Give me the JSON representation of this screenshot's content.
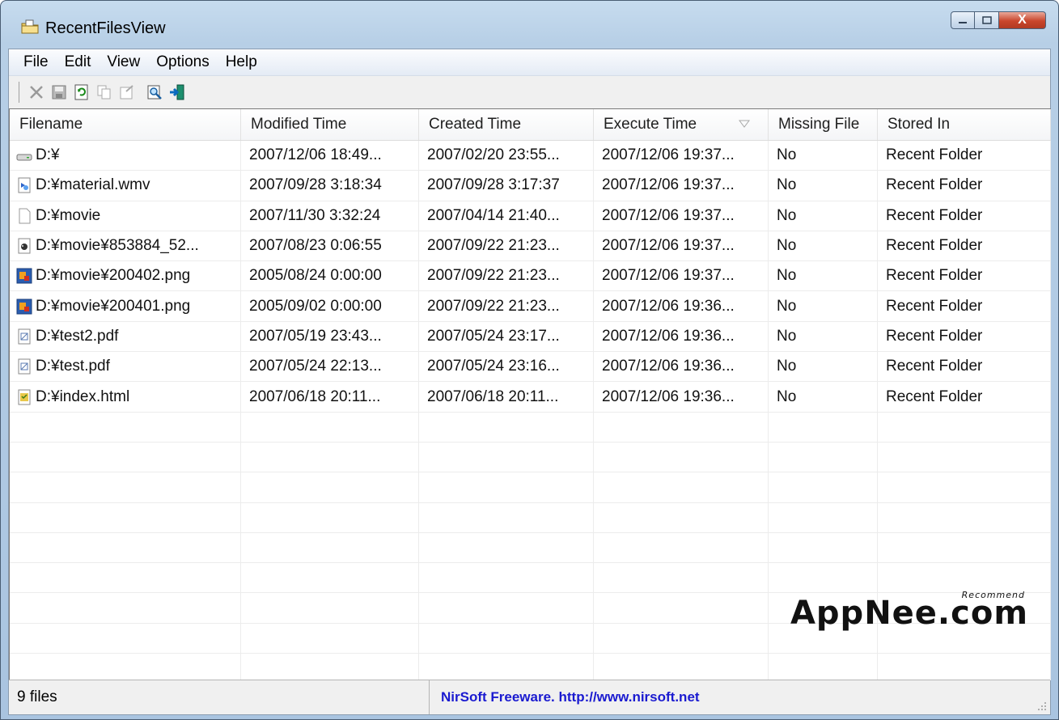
{
  "window": {
    "title": "RecentFilesView",
    "close_glyph": "X"
  },
  "menu": [
    "File",
    "Edit",
    "View",
    "Options",
    "Help"
  ],
  "toolbar": {
    "icons": [
      "delete-icon",
      "save-icon",
      "refresh-icon",
      "copy-icon",
      "properties-icon",
      "find-icon",
      "exit-icon"
    ]
  },
  "columns": [
    "Filename",
    "Modified Time",
    "Created Time",
    "Execute Time",
    "Missing File",
    "Stored In"
  ],
  "sort_column": "Execute Time",
  "rows": [
    {
      "icon": "drive-icon",
      "cells": [
        "D:¥",
        "2007/12/06 18:49...",
        "2007/02/20 23:55...",
        "2007/12/06 19:37...",
        "No",
        "Recent Folder"
      ]
    },
    {
      "icon": "media-file-icon",
      "cells": [
        "D:¥material.wmv",
        "2007/09/28 3:18:34",
        "2007/09/28 3:17:37",
        "2007/12/06 19:37...",
        "No",
        "Recent Folder"
      ]
    },
    {
      "icon": "blank-file-icon",
      "cells": [
        "D:¥movie",
        "2007/11/30 3:32:24",
        "2007/04/14 21:40...",
        "2007/12/06 19:37...",
        "No",
        "Recent Folder"
      ]
    },
    {
      "icon": "video-file-icon",
      "cells": [
        "D:¥movie¥853884_52...",
        "2007/08/23 0:06:55",
        "2007/09/22 21:23...",
        "2007/12/06 19:37...",
        "No",
        "Recent Folder"
      ]
    },
    {
      "icon": "image-file-icon",
      "cells": [
        "D:¥movie¥200402.png",
        "2005/08/24 0:00:00",
        "2007/09/22 21:23...",
        "2007/12/06 19:37...",
        "No",
        "Recent Folder"
      ]
    },
    {
      "icon": "image-file-icon",
      "cells": [
        "D:¥movie¥200401.png",
        "2005/09/02 0:00:00",
        "2007/09/22 21:23...",
        "2007/12/06 19:36...",
        "No",
        "Recent Folder"
      ]
    },
    {
      "icon": "pdf-file-icon",
      "cells": [
        "D:¥test2.pdf",
        "2007/05/19 23:43...",
        "2007/05/24 23:17...",
        "2007/12/06 19:36...",
        "No",
        "Recent Folder"
      ]
    },
    {
      "icon": "pdf-file-icon",
      "cells": [
        "D:¥test.pdf",
        "2007/05/24 22:13...",
        "2007/05/24 23:16...",
        "2007/12/06 19:36...",
        "No",
        "Recent Folder"
      ]
    },
    {
      "icon": "html-file-icon",
      "cells": [
        "D:¥index.html",
        "2007/06/18 20:11...",
        "2007/06/18 20:11...",
        "2007/12/06 19:36...",
        "No",
        "Recent Folder"
      ]
    }
  ],
  "empty_rows": 9,
  "status": {
    "count": "9 files",
    "credit": "NirSoft Freeware.  http://www.nirsoft.net"
  },
  "watermark": {
    "text": "AppNee.com",
    "tag": "Recommend"
  }
}
